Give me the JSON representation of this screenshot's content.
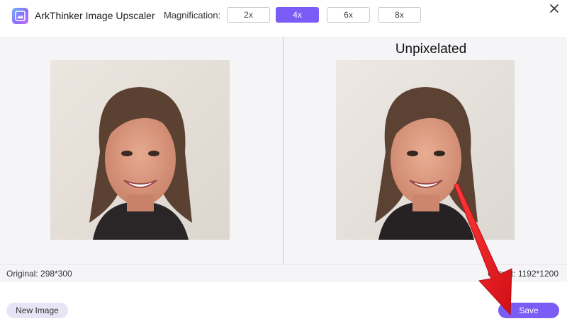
{
  "app": {
    "title": "ArkThinker Image Upscaler",
    "logo_icon": "image-upscale-icon"
  },
  "magnification": {
    "label": "Magnification:",
    "options": [
      "2x",
      "4x",
      "6x",
      "8x"
    ],
    "selected": "4x"
  },
  "window": {
    "close_icon": "close-icon"
  },
  "preview": {
    "overlay_label": "Unpixelated",
    "original_info": "Original: 298*300",
    "output_info": "Output: 1192*1200"
  },
  "footer": {
    "new_image_label": "New Image",
    "save_label": "Save"
  },
  "colors": {
    "accent": "#7b5cf5",
    "annotation_arrow": "#e8141c"
  }
}
